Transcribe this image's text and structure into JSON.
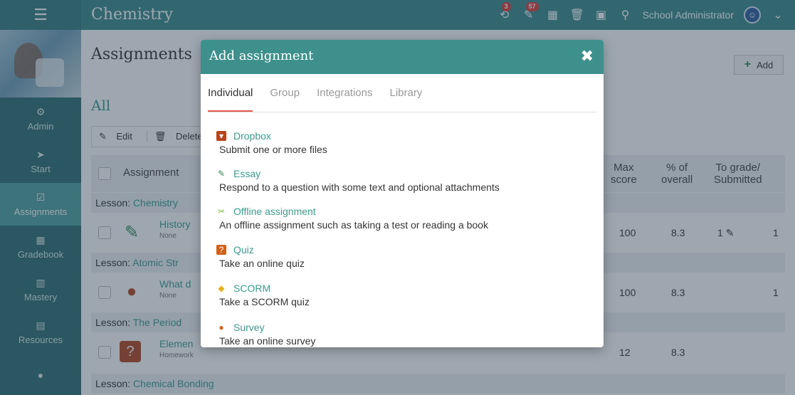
{
  "topbar": {
    "title": "Chemistry",
    "badge_notifications": "3",
    "badge_announcements": "57",
    "user_name": "School Administrator"
  },
  "sidebar": {
    "items": [
      {
        "label": "Admin",
        "icon": "gear-icon"
      },
      {
        "label": "Start",
        "icon": "paper-plane-icon"
      },
      {
        "label": "Assignments",
        "icon": "check-square-icon"
      },
      {
        "label": "Gradebook",
        "icon": "table-icon"
      },
      {
        "label": "Mastery",
        "icon": "bar-chart-icon"
      },
      {
        "label": "Resources",
        "icon": "grid-icon"
      }
    ]
  },
  "main": {
    "page_title": "Assignments",
    "add_label": "Add",
    "filter": "All",
    "toolbar": {
      "edit": "Edit",
      "delete": "Delete"
    },
    "columns": {
      "assignment": "Assignment",
      "max_score_1": "Max",
      "max_score_2": "score",
      "pct_1": "% of",
      "pct_2": "overall",
      "grade_1": "To grade/",
      "grade_2": "Submitted"
    },
    "lesson_prefix": "Lesson:",
    "lessons": [
      "Chemistry",
      "Atomic Str",
      "The Period",
      "Chemical Bonding"
    ],
    "rows": [
      {
        "name": "History",
        "sub": "None",
        "max": "100",
        "pct": "8.3",
        "to_grade": "1",
        "submitted": "1"
      },
      {
        "name": "What d",
        "sub": "None",
        "max": "100",
        "pct": "8.3",
        "to_grade": "",
        "submitted": "1"
      },
      {
        "name": "Elemen",
        "sub": "Homework",
        "max": "12",
        "pct": "8.3",
        "to_grade": "",
        "submitted": ""
      }
    ]
  },
  "modal": {
    "title": "Add assignment",
    "tabs": [
      "Individual",
      "Group",
      "Integrations",
      "Library"
    ],
    "options": [
      {
        "label": "Dropbox",
        "desc": "Submit one or more files",
        "color": "#b4451f"
      },
      {
        "label": "Essay",
        "desc": "Respond to a question with some text and optional attachments",
        "color": "#2e8b57"
      },
      {
        "label": "Offline assignment",
        "desc": "An offline assignment such as taking a test or reading a book",
        "color": "#7cba3d"
      },
      {
        "label": "Quiz",
        "desc": "Take an online quiz",
        "color": "#d2601a"
      },
      {
        "label": "SCORM",
        "desc": "Take a SCORM quiz",
        "color": "#e3b320"
      },
      {
        "label": "Survey",
        "desc": "Take an online survey",
        "color": "#d2601a"
      }
    ]
  }
}
